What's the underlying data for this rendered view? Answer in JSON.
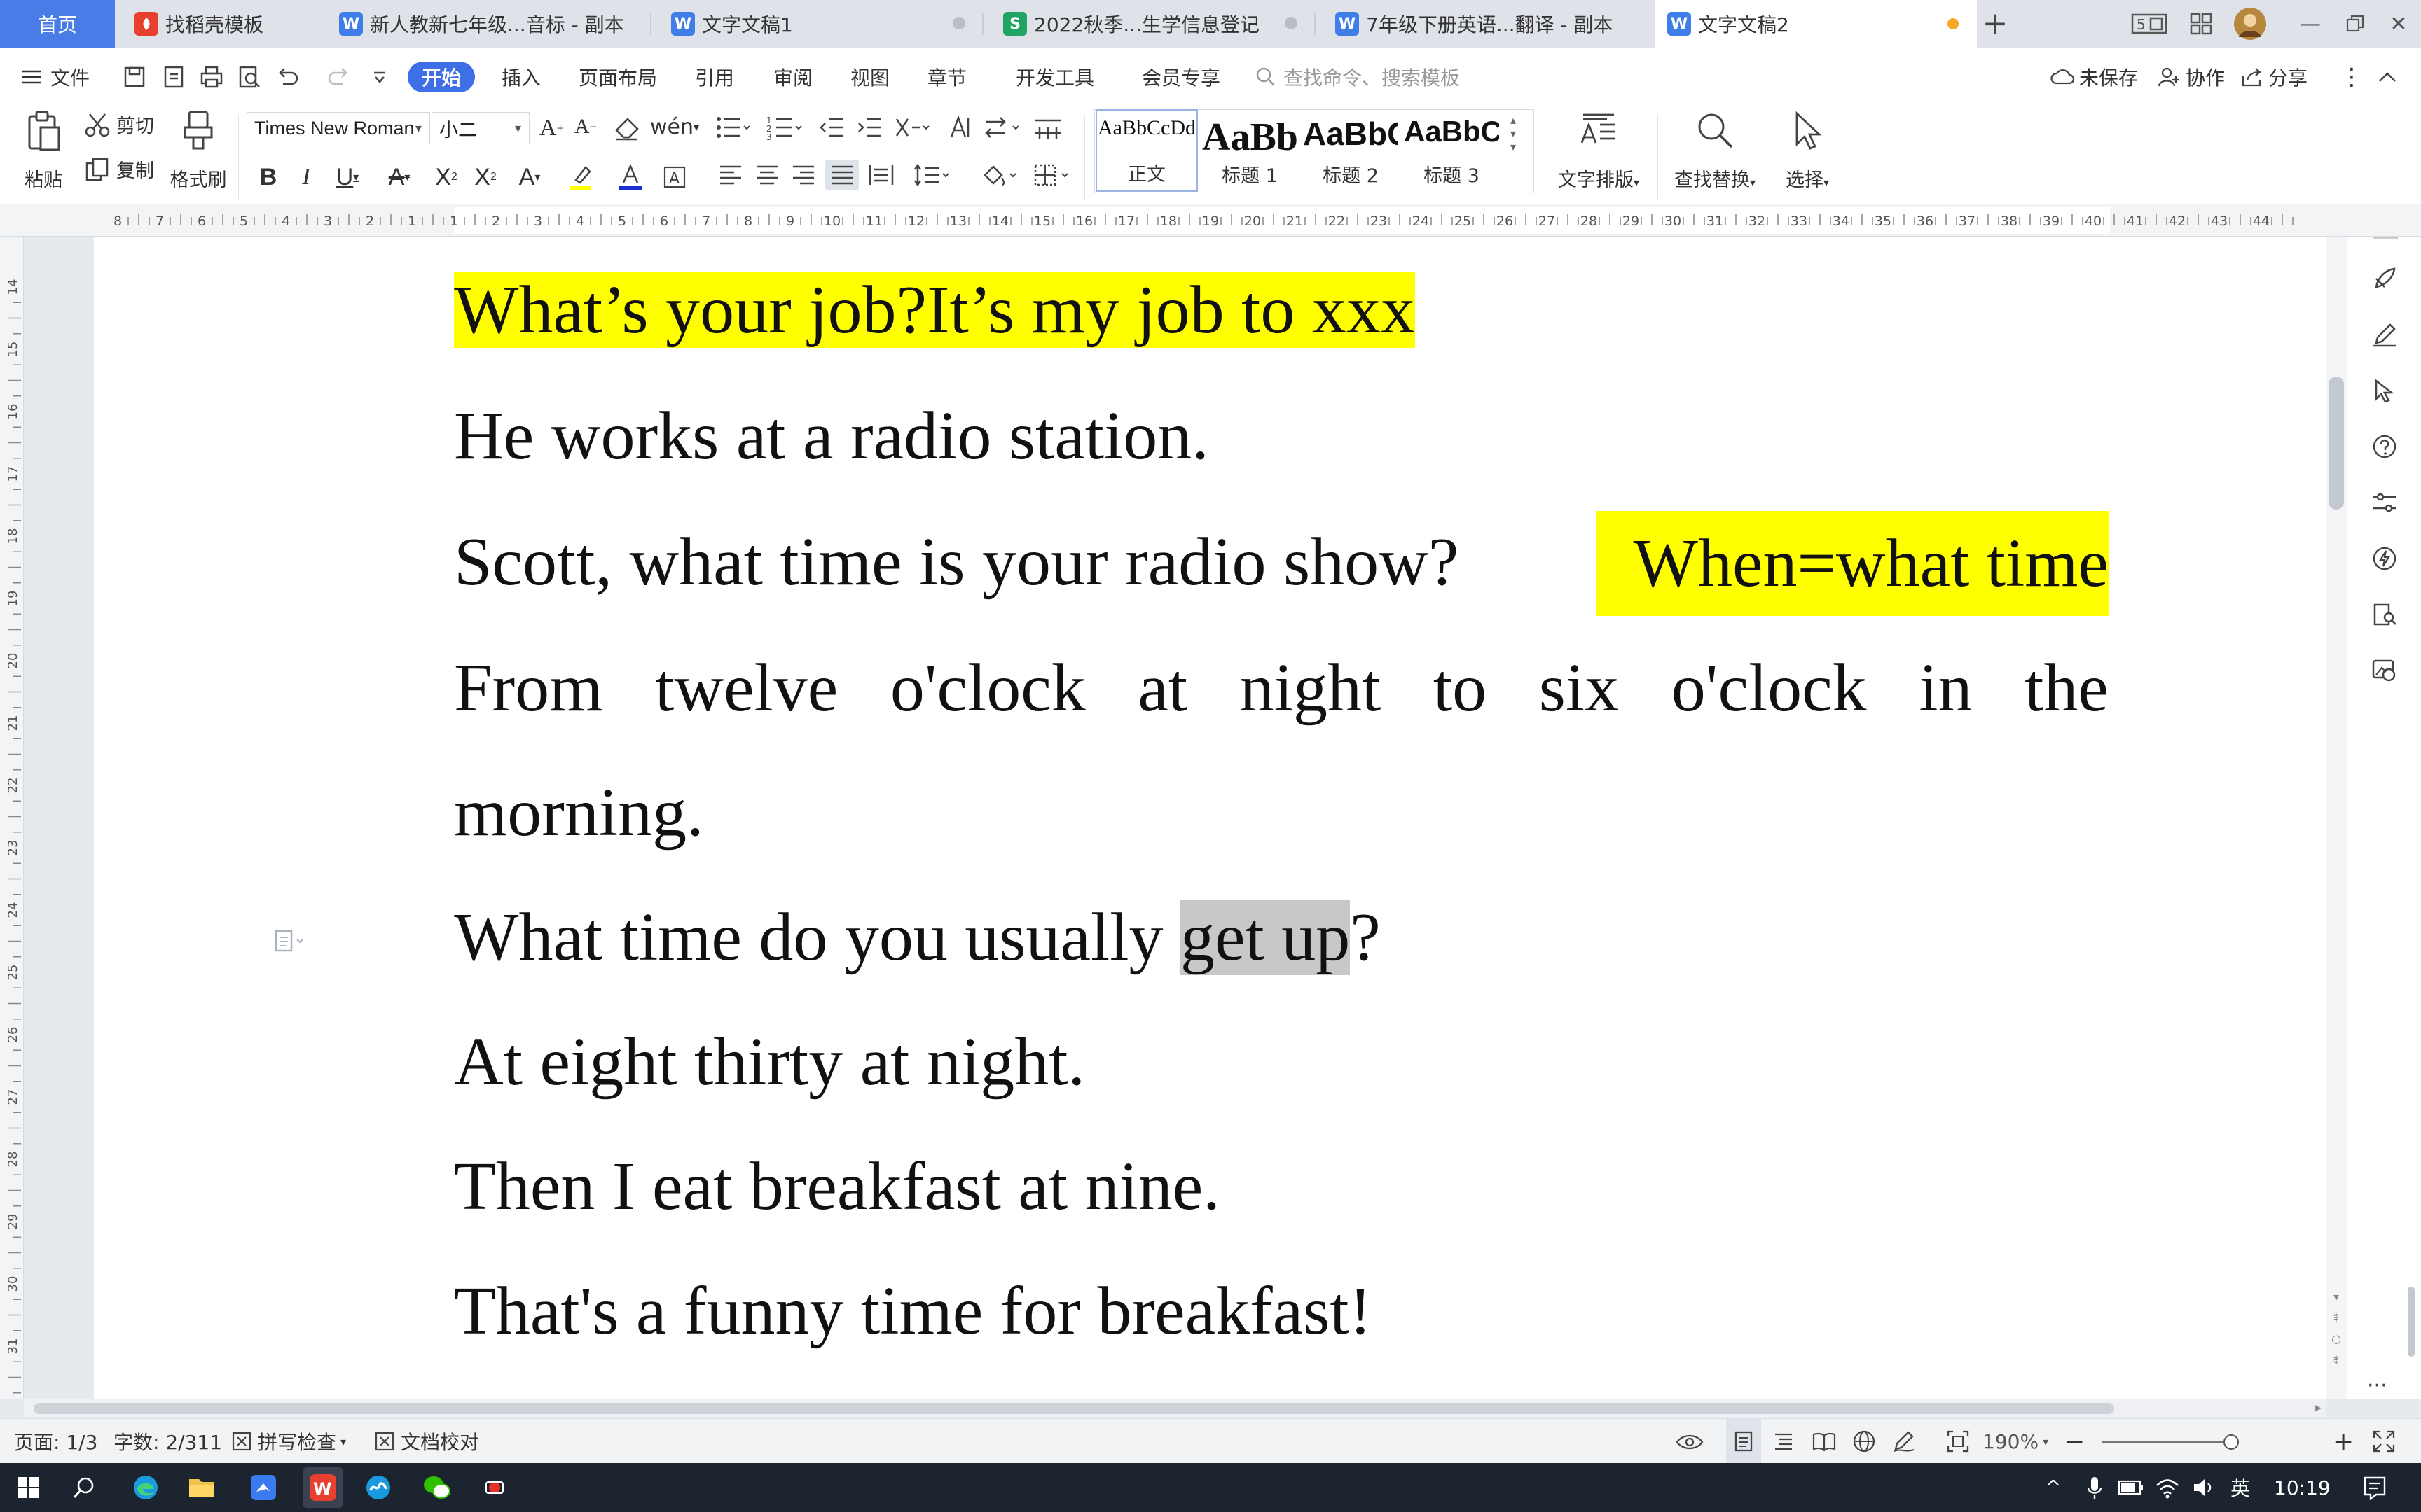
{
  "tabs": [
    {
      "label": "首页",
      "kind": "home"
    },
    {
      "label": "找稻壳模板",
      "kind": "docer",
      "icon": "docer-icon",
      "color": "#e8402f"
    },
    {
      "label": "新人教新七年级...音标 - 副本",
      "kind": "word",
      "icon": "wps-writer-icon",
      "color": "#3f7ee8"
    },
    {
      "label": "文字文稿1",
      "kind": "word",
      "icon": "wps-writer-icon",
      "color": "#3f7ee8"
    },
    {
      "label": "2022秋季...生学信息登记",
      "kind": "sheet",
      "icon": "wps-sheet-icon",
      "color": "#1fa463"
    },
    {
      "label": "7年级下册英语...翻译 - 副本",
      "kind": "word",
      "icon": "wps-writer-icon",
      "color": "#3f7ee8"
    },
    {
      "label": "文字文稿2",
      "kind": "word",
      "icon": "wps-writer-icon",
      "color": "#3f7ee8",
      "active": true
    }
  ],
  "menu": {
    "file_label": "文件",
    "items": [
      "开始",
      "插入",
      "页面布局",
      "引用",
      "审阅",
      "视图",
      "章节",
      "开发工具",
      "会员专享"
    ],
    "active_item": "开始",
    "search_placeholder": "查找命令、搜索模板",
    "unsaved_label": "未保存",
    "collab_label": "协作",
    "share_label": "分享"
  },
  "ribbon": {
    "paste_label": "粘贴",
    "cut_label": "剪切",
    "copy_label": "复制",
    "format_painter_label": "格式刷",
    "font_name": "Times New Roman",
    "font_size": "小二",
    "styles": [
      {
        "preview": "AaBbCcDd",
        "name": "正文"
      },
      {
        "preview": "AaBb",
        "name": "标题 1"
      },
      {
        "preview": "AaBbC",
        "name": "标题 2"
      },
      {
        "preview": "AaBbC",
        "name": "标题 3"
      }
    ],
    "text_layout_label": "文字排版",
    "find_replace_label": "查找替换",
    "select_label": "选择"
  },
  "ruler": {
    "h_ticks": [
      "8",
      "7",
      "6",
      "5",
      "4",
      "3",
      "2",
      "1",
      "1",
      "2",
      "3",
      "4",
      "5",
      "6",
      "7",
      "8",
      "9",
      "10",
      "11",
      "12",
      "13",
      "14",
      "15",
      "16",
      "17",
      "18",
      "19",
      "20",
      "21",
      "22",
      "23",
      "24",
      "25",
      "26",
      "27",
      "28",
      "29",
      "30",
      "31",
      "32",
      "33",
      "34",
      "35",
      "36",
      "37",
      "38",
      "39",
      "40",
      "41",
      "42",
      "43",
      "44"
    ],
    "v_ticks": [
      "14",
      "15",
      "16",
      "17",
      "18",
      "19",
      "20",
      "21",
      "22",
      "23",
      "24",
      "25",
      "26",
      "27",
      "28",
      "29",
      "30",
      "31"
    ]
  },
  "document": {
    "line1_highlighted": "What’s your job?It’s my job to xxx",
    "line2": "He works at a radio station.",
    "line3": "Scott, what time is your radio show?",
    "line3_highlighted": "When=what time",
    "line4_words": [
      "From",
      "twelve",
      "o'clock",
      "at",
      "night",
      "to",
      "six",
      "o'clock",
      "in",
      "the"
    ],
    "line5": "morning.",
    "line6_before": "What time do you usually ",
    "line6_selected": "get up",
    "line6_after": "?",
    "line7": "At eight thirty at night.",
    "line8": "Then I eat breakfast at nine.",
    "line9": "That's a funny time for breakfast!"
  },
  "status": {
    "page": "页面: 1/3",
    "word_count": "字数: 2/311",
    "spell_check": "拼写检查",
    "doc_proof": "文档校对",
    "zoom": "190%",
    "zoom_level_percent": 190
  },
  "taskbar": {
    "ime_label": "英",
    "time": "10:19"
  },
  "colors": {
    "accent": "#3f6fe6",
    "highlight_yellow": "#ffff00",
    "selection_grey": "#c8c8c8",
    "home_tab": "#4a7ce8"
  }
}
